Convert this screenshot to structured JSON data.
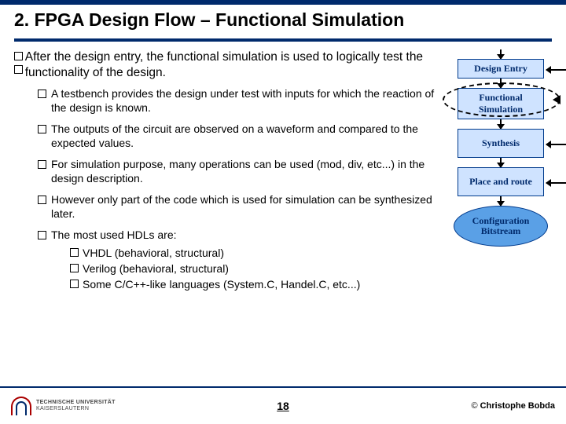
{
  "title": "2. FPGA Design Flow – Functional Simulation",
  "intro": "After the design entry, the functional simulation is used to logically test the functionality of the design.",
  "bullets": [
    "A testbench provides the design under test with inputs for which the reaction of the design is known.",
    "The outputs of the circuit are observed on a waveform and compared to the expected values.",
    "For simulation purpose, many operations can be used (mod, div, etc...) in the design description.",
    "However only part of the code which is used for simulation can be synthesized later.",
    "The most used HDLs are:"
  ],
  "sublist": [
    "VHDL (behavioral, structural)",
    "Verilog (behavioral, structural)",
    "Some C/C++-like languages (System.C, Handel.C, etc...)"
  ],
  "diagram": {
    "b1": "Design Entry",
    "b2": "Functional Simulation",
    "b3": "Synthesis",
    "b4": "Place and route",
    "b5": "Configuration Bitstream"
  },
  "footer": {
    "uni_line1": "TECHNISCHE UNIVERSITÄT",
    "uni_line2": "KAISERSLAUTERN",
    "page": "18",
    "copy_symbol": "©",
    "copy_name": "Christophe Bobda"
  }
}
